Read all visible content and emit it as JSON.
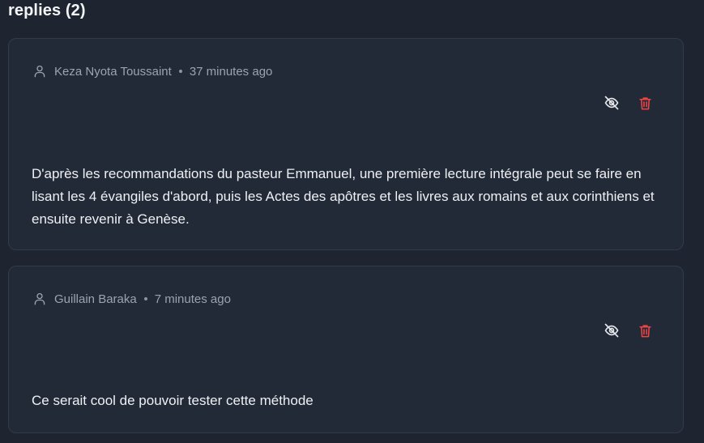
{
  "section": {
    "title": "replies (2)"
  },
  "colors": {
    "background": "#1e2430",
    "card": "#222a37",
    "border": "#323b4a",
    "text": "#eef0f4",
    "muted": "#9aa3b2",
    "hide_icon": "#e5e7eb",
    "delete_icon": "#ef4444"
  },
  "replies": [
    {
      "author": "Keza Nyota Toussaint",
      "time": "37 minutes ago",
      "text": "D'après les recommandations du pasteur Emmanuel, une première lecture intégrale peut se faire en lisant les 4 évangiles d'abord, puis les Actes des apôtres et les livres aux romains et aux corinthiens et ensuite revenir à Genèse.",
      "icons": {
        "user": "user-icon",
        "hide": "eye-off-icon",
        "delete": "trash-icon"
      }
    },
    {
      "author": "Guillain Baraka",
      "time": "7 minutes ago",
      "text": "Ce serait cool de pouvoir tester cette méthode",
      "icons": {
        "user": "user-icon",
        "hide": "eye-off-icon",
        "delete": "trash-icon"
      }
    }
  ]
}
